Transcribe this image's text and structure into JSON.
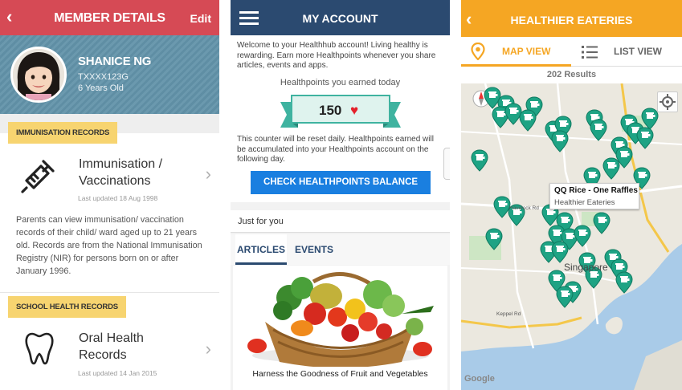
{
  "member": {
    "header_title": "MEMBER DETAILS",
    "back_glyph": "‹",
    "edit_label": "Edit",
    "name": "SHANICE NG",
    "id": "TXXXX123G",
    "age": "6 Years Old",
    "immunisation_tag": "IMMUNISATION RECORDS",
    "immunisation_title_1": "Immunisation /",
    "immunisation_title_2": "Vaccinations",
    "immunisation_updated": "Last updated 18 Aug 1998",
    "immunisation_note": "Parents can view immunisation/ vaccination records of their child/ ward aged up to 21 years old. Records are from the National Immunisation Registry (NIR) for persons born on or after January 1996.",
    "school_tag": "SCHOOL HEALTH RECORDS",
    "oral_title_1": "Oral Health",
    "oral_title_2": "Records",
    "oral_updated": "Last updated 14 Jan 2015",
    "chevron": "›",
    "header_color": "#d64a55",
    "tag_color": "#f7d470"
  },
  "account": {
    "header_title": "MY ACCOUNT",
    "welcome": "Welcome to your Healthhub account! Living healthy is rewarding. Earn more Healthpoints whenever you share articles, events and apps.",
    "earned_label": "Healthpoints you earned today",
    "points": "150",
    "heart": "♥",
    "reset_note": "This counter will be reset daily. Healthpoints earned will be accumulated into your Healthpoints account on the following day.",
    "button_label": "CHECK HEALTHPOINTS BALANCE",
    "just_for_you": "Just for you",
    "tabs": [
      "ARTICLES",
      "EVENTS"
    ],
    "active_tab": "ARTICLES",
    "article_caption": "Harness the Goodness of Fruit and Vegetables",
    "header_color": "#2b4a70",
    "button_color": "#1a7fe0"
  },
  "eateries": {
    "header_title": "HEALTHIER EATERIES",
    "back_glyph": "‹",
    "tab_map": "MAP VIEW",
    "tab_list": "LIST VIEW",
    "active_tab": "MAP VIEW",
    "results": "202 Results",
    "callout_title": "QQ Rice - One Raffles",
    "callout_subtitle": "Healthier Eateries",
    "map_labels": [
      "Singapore",
      "Keppel Rd",
      "Havelock Rd",
      "Google"
    ],
    "marker_color": "#1ea384",
    "header_color": "#f5a623",
    "marker_icon": "fork-knife-marker-icon"
  }
}
